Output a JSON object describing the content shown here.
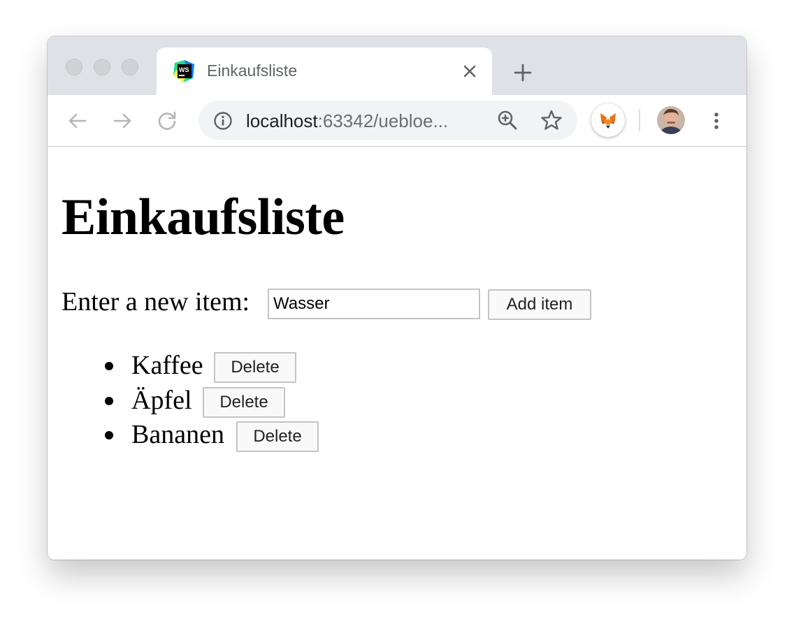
{
  "browser": {
    "tab_title": "Einkaufsliste",
    "url_host": "localhost",
    "url_rest": ":63342/uebloe..."
  },
  "page": {
    "heading": "Einkaufsliste",
    "input_label": "Enter a new item:",
    "input_value": "Wasser",
    "add_button_label": "Add item",
    "items": [
      {
        "label": "Kaffee",
        "delete_label": "Delete"
      },
      {
        "label": "Äpfel",
        "delete_label": "Delete"
      },
      {
        "label": "Bananen",
        "delete_label": "Delete"
      }
    ]
  },
  "icons": {
    "tab_favicon": "webstorm-icon",
    "tab_close": "close-icon",
    "new_tab": "plus-icon",
    "back": "arrow-left-icon",
    "forward": "arrow-right-icon",
    "reload": "reload-icon",
    "site_info": "info-icon",
    "zoom": "zoom-icon",
    "bookmark": "star-icon",
    "extension": "metamask-fox-icon",
    "profile": "avatar",
    "menu": "kebab-menu-icon"
  },
  "colors": {
    "tab_strip": "#dee1e6",
    "omnibox": "#f1f3f4",
    "icon_gray": "#5f6368",
    "button_border": "#c4c4c4"
  }
}
